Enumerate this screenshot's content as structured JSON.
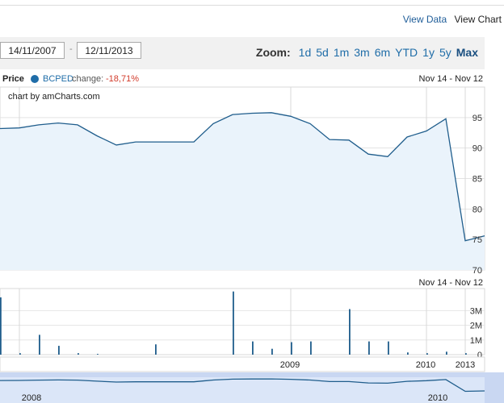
{
  "view_links": {
    "data": "View Data",
    "chart": "View Chart"
  },
  "date_range": {
    "from": "14/11/2007",
    "to": "12/11/2013",
    "separator": "-"
  },
  "zoom": {
    "label": "Zoom:",
    "options": [
      "1d",
      "5d",
      "1m",
      "3m",
      "6m",
      "YTD",
      "1y",
      "5y",
      "Max"
    ],
    "active": "Max"
  },
  "legend": {
    "label": "Price",
    "series": "BCPED",
    "change_label": "change:",
    "change_value": "-18,71%",
    "range": "Nov 14 - Nov 12"
  },
  "volume_range": "Nov 14 - Nov 12",
  "credit": "chart by amCharts.com",
  "colors": {
    "line": "#1f5d8c",
    "fill": "#eaf3fb",
    "accent": "#1f6da8",
    "negative": "#d23b2b"
  },
  "chart_data": [
    {
      "type": "area",
      "series": [
        {
          "name": "BCPED",
          "x": [
            0,
            24,
            48,
            72,
            96,
            120,
            144,
            168,
            192,
            216,
            240,
            264,
            288,
            312,
            336,
            360,
            384,
            408,
            432,
            456,
            480,
            504,
            528,
            552,
            576,
            600
          ],
          "values": [
            93.2,
            93.3,
            93.8,
            94.1,
            93.8,
            92.0,
            90.5,
            91.0,
            91.0,
            91.0,
            91.0,
            94.0,
            95.5,
            95.7,
            95.8,
            95.2,
            94.0,
            91.4,
            91.3,
            89.0,
            88.6,
            91.8,
            92.8,
            94.8,
            74.8,
            75.6
          ]
        }
      ],
      "ylim": [
        70,
        100
      ],
      "y_ticks": [
        "95",
        "90",
        "85",
        "80",
        "75",
        "70"
      ],
      "grid": true
    },
    {
      "type": "bar",
      "series": [
        {
          "name": "Volume",
          "x": [
            0,
            24,
            48,
            72,
            96,
            120,
            192,
            288,
            312,
            336,
            360,
            384,
            432,
            456,
            480,
            504,
            528,
            552,
            576
          ],
          "values": [
            3.9,
            0.1,
            1.35,
            0.6,
            0.1,
            0.05,
            0.7,
            4.3,
            0.9,
            0.4,
            0.85,
            0.9,
            3.1,
            0.9,
            0.9,
            0.15,
            0.1,
            0.2,
            0.1
          ]
        }
      ],
      "ylim": [
        0,
        4.5
      ],
      "y_ticks": [
        "3M",
        "2M",
        "1M",
        "0"
      ],
      "grid": true
    },
    {
      "type": "area",
      "name": "navigator",
      "x_ticks": [
        "2009",
        "2010",
        "2013"
      ],
      "scroll_ticks": [
        "2008",
        "2010"
      ]
    }
  ]
}
